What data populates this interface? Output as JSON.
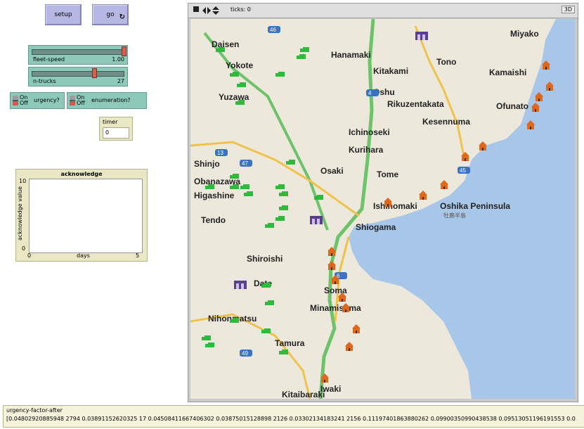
{
  "buttons": {
    "setup": "setup",
    "go": "go",
    "go_forever": "↻"
  },
  "sliders": [
    {
      "name": "fleet-speed",
      "value": "1.00",
      "position": 0.98
    },
    {
      "name": "n-trucks",
      "value": "27",
      "position": 0.62
    }
  ],
  "switches": [
    {
      "name": "urgency?",
      "on": "On",
      "off": "Off",
      "state": "off"
    },
    {
      "name": "enumeration?",
      "on": "On",
      "off": "Off",
      "state": "off"
    }
  ],
  "monitor": {
    "name": "timer",
    "value": "0"
  },
  "plot": {
    "title": "acknowledge",
    "ylabel": "acknowledge value",
    "xlabel": "days",
    "xmin": "0",
    "xmax": "5",
    "ymin": "0",
    "ymax": "10"
  },
  "view": {
    "ticks_label": "ticks: 0",
    "three_d": "3D"
  },
  "map": {
    "cities": [
      "Daisen",
      "Hanamaki",
      "Tono",
      "Miyako",
      "Yokote",
      "Kitakami",
      "Kamaishi",
      "Yuzawa",
      "Oshu",
      "Rikuzentakata",
      "Ofunato",
      "Kesennuma",
      "Ichinoseki",
      "Shinjo",
      "Kurihara",
      "Obanazawa",
      "Osaki",
      "Tome",
      "Higashine",
      "Ishinomaki",
      "Tendo",
      "Shiogama",
      "Oshika Peninsula",
      "Shiroishi",
      "Date",
      "Soma",
      "Minamisoma",
      "Nihonmatsu",
      "Tamura",
      "Iwaki",
      "Kitaibaraki"
    ],
    "route_numbers": [
      "46",
      "13",
      "47",
      "45",
      "6",
      "49",
      "4"
    ],
    "oshika_sub": "牡鹿半島",
    "colors": {
      "truck": "#2dbb3c",
      "depot": "#5a3f8f",
      "village": "#e0681d",
      "sea": "#a8c6e8",
      "land": "#ece8dc",
      "highway": "#6cc36a",
      "road": "#f0c24a"
    }
  },
  "output": {
    "name": "urgency-factor-after",
    "value": "[0.04802920885948 2794 0.03891152620325 17 0.04508411667406302 0.03875015128898 2126 0.03302134183241 2156 0.11197401863880262 0.09900350990438538 0.09513051196191553 0.0"
  }
}
